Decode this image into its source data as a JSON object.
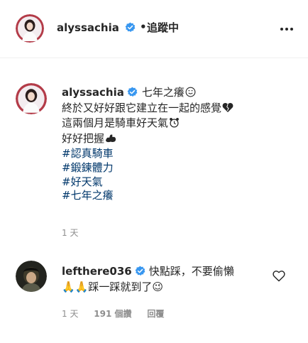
{
  "header": {
    "username": "alyssachia",
    "separator": "•",
    "follow_label": "追蹤中"
  },
  "caption": {
    "username": "alyssachia",
    "text_first": "七年之癢",
    "lines": [
      "終於又好好跟它建立在一起的感覺",
      "這兩個月是騎車好天氣",
      "好好把握"
    ],
    "hashtags": [
      "#認真騎車",
      "#鍛鍊體力",
      "#好天氣",
      "#七年之癢"
    ],
    "time": "1 天"
  },
  "comment": {
    "username": "lefthere036",
    "text_line1": "快點踩，不要偷懶",
    "text_line2": "🙏🙏踩一踩就到了😉",
    "time": "1 天",
    "likes": "191 個讚",
    "reply": "回覆"
  },
  "colors": {
    "verified": "#3897f0",
    "hashtag": "#00376b",
    "muted": "#8e8e8e"
  },
  "icons": {
    "more": "more-horizontal-icon",
    "verified": "verified-badge-icon",
    "heart": "heart-outline-icon"
  }
}
